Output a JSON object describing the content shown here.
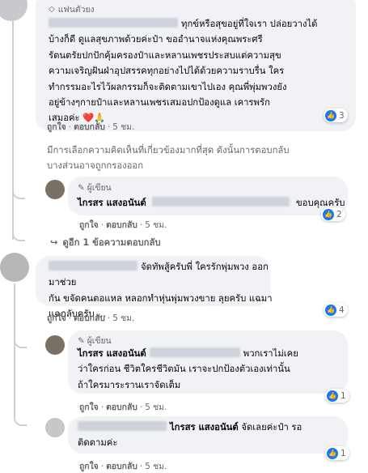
{
  "top_fan": {
    "label": "แฟนตัวยง",
    "icon": "diamond-icon"
  },
  "comment1": {
    "lines": [
      "ทุกข์หรือสุขอยู่ที่ใจเรา ปล่อยวางได้",
      "บ้างก็ดี ดูแลสุขภาพด้วยค่ะป๋า ขออำนาจแห่งคุณพระศรี",
      "รัตนตรัยปกปักคุ้มครองป๋าและหลานเพชรประสบแต่ความสุข",
      "ความเจริญฝันฝ่าอุปสรรคทุกอย่างไปได้ด้วยความราบรื่น ใคร",
      "ทำกรรมอะไรไว้ผลกรรมก็จะติดตามเขาไปเอง คุณพี่พุ่มพวงยัง",
      "อยู่ข้างๆกายป๋าและหลานเพชรเสมอปกป้องดูแล เคารพรัก",
      "เสมอค่ะ"
    ],
    "emoji": "❤️🙏",
    "reactions": "3",
    "like_label": "ถูกใจ",
    "reply_label": "ตอบกลับ",
    "time": "5 ชม."
  },
  "filter_notice": "มีการเลือกความคิดเห็นที่เกี่ยวข้องมากที่สุด ดังนั้นการตอบกลับบางส่วนอาจถูกกรองออก",
  "filter_notice_lines": [
    "มีการเลือกความคิดเห็นที่เกี่ยวข้องมากที่สุด ดังนั้นการตอบกลับ",
    "บางส่วนอาจถูกกรองออก"
  ],
  "reply1": {
    "author_tag": "ผู้เขียน",
    "author": "ไกรสร แสงอนันต์",
    "text": "ขอบคุณครับ",
    "reactions": "2",
    "like_label": "ถูกใจ",
    "reply_label": "ตอบกลับ",
    "time": "5 ชม."
  },
  "more_replies": "ดูอีก 1 ข้อความตอบกลับ",
  "comment2": {
    "lines": [
      "จัดทัพสู้ครับพี่ ใครรักพุ่มพวง ออกมาช่วย",
      "กัน ขจัดคนตอแหล หลอกทำหุ่นพุ่มพวงขาย ลุยครับ แฉมา",
      "แฉกลับครับ ..."
    ],
    "reactions": "4",
    "like_label": "ถูกใจ",
    "reply_label": "ตอบกลับ",
    "time": "5 ชม."
  },
  "reply2": {
    "author_tag": "ผู้เขียน",
    "author": "ไกรสร แสงอนันต์",
    "lines": [
      "พวกเราไม่เคย",
      "ว่าใครก่อน ชีวิตใครชีวิตมัน เราจะปกป้องตัวเองเท่านั้น",
      "ถ้าใครมาระรานเราจัดเต็ม"
    ],
    "reactions": "1",
    "like_label": "ถูกใจ",
    "reply_label": "ตอบกลับ",
    "time": "5 ชม."
  },
  "reply3": {
    "mention": "ไกรสร แสงอนันต์",
    "lines": [
      "จัดเลยค่ะป๋า รอ",
      "ติดตามค่ะ"
    ],
    "reactions": "1",
    "like_label": "ถูกใจ",
    "reply_label": "ตอบกลับ",
    "time": "5 ชม."
  },
  "colors": {
    "bubble": "#f0f2f5",
    "meta": "#65676b",
    "like": "#1877f2",
    "text": "#050505"
  }
}
